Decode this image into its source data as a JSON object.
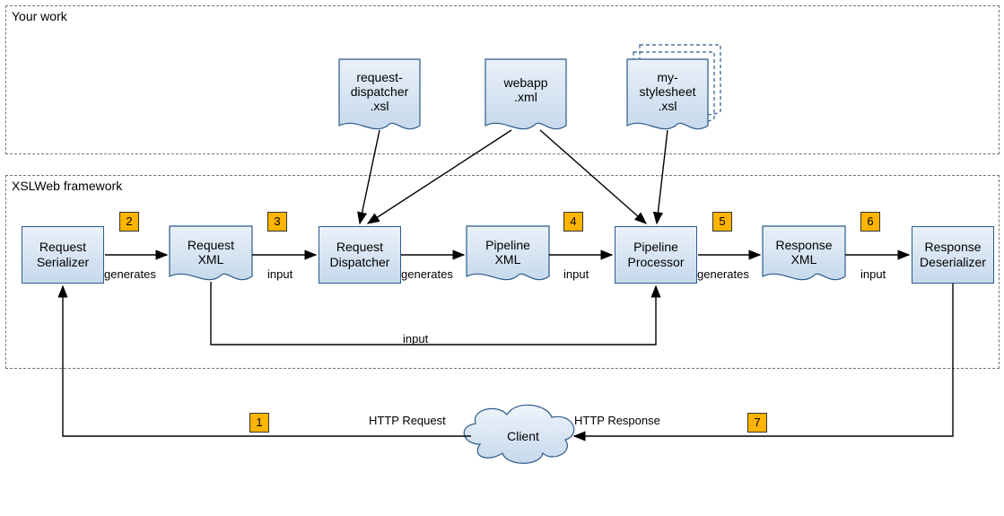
{
  "sections": {
    "your_work": "Your work",
    "framework": "XSLWeb framework"
  },
  "top_docs": {
    "request_dispatcher": "request-\ndispatcher\n.xsl",
    "webapp": "webapp\n.xml",
    "stylesheet": "my-\nstylesheet\n.xsl"
  },
  "pipeline": {
    "request_serializer": "Request\nSerializer",
    "request_xml": "Request\nXML",
    "request_dispatcher": "Request\nDispatcher",
    "pipeline_xml": "Pipeline\nXML",
    "pipeline_processor": "Pipeline\nProcessor",
    "response_xml": "Response\nXML",
    "response_deserializer": "Response\nDeserializer"
  },
  "badges": {
    "b1": "1",
    "b2": "2",
    "b3": "3",
    "b4": "4",
    "b5": "5",
    "b6": "6",
    "b7": "7"
  },
  "edges": {
    "generates1": "generates",
    "input1": "input",
    "generates2": "generates",
    "input2": "input",
    "generates3": "generates",
    "input3": "input",
    "input_loop": "input",
    "http_request": "HTTP Request",
    "http_response": "HTTP Response"
  },
  "client": "Client"
}
